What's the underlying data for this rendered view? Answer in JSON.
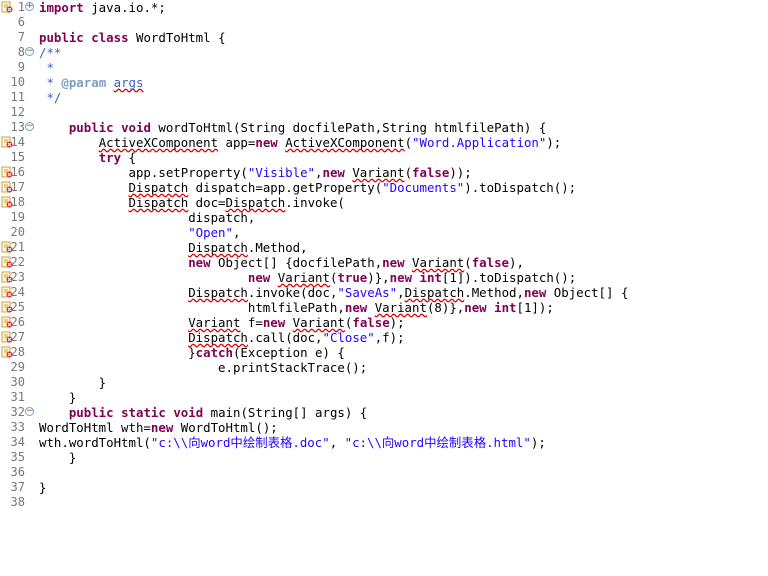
{
  "editor": {
    "lines": [
      {
        "n": "1",
        "fold": "plus",
        "marker": true,
        "tokens": [
          {
            "t": "import",
            "c": "kw"
          },
          {
            "t": " java.io.*;"
          }
        ]
      },
      {
        "n": "6",
        "tokens": []
      },
      {
        "n": "7",
        "tokens": [
          {
            "t": "public",
            "c": "kw"
          },
          {
            "t": " "
          },
          {
            "t": "class",
            "c": "kw"
          },
          {
            "t": " WordToHtml {"
          }
        ]
      },
      {
        "n": "8",
        "fold": "minus",
        "tokens": [
          {
            "t": "/**",
            "c": "cmt"
          }
        ]
      },
      {
        "n": "9",
        "tokens": [
          {
            "t": " *",
            "c": "cmt"
          }
        ]
      },
      {
        "n": "10",
        "tokens": [
          {
            "t": " * ",
            "c": "cmt"
          },
          {
            "t": "@param",
            "c": "tag"
          },
          {
            "t": " ",
            "c": "cmt"
          },
          {
            "t": "args",
            "c": "cmt err"
          }
        ]
      },
      {
        "n": "11",
        "tokens": [
          {
            "t": " */",
            "c": "cmt"
          }
        ]
      },
      {
        "n": "12",
        "tokens": []
      },
      {
        "n": "13",
        "fold": "minus",
        "tokens": [
          {
            "t": "    "
          },
          {
            "t": "public",
            "c": "kw"
          },
          {
            "t": " "
          },
          {
            "t": "void",
            "c": "kw"
          },
          {
            "t": " wordToHtml(String docfilePath,String htmlfilePath) {"
          }
        ]
      },
      {
        "n": "14",
        "marker": true,
        "tokens": [
          {
            "t": "        "
          },
          {
            "t": "ActiveXComponent",
            "c": "err"
          },
          {
            "t": " app="
          },
          {
            "t": "new",
            "c": "kw"
          },
          {
            "t": " "
          },
          {
            "t": "ActiveXComponent",
            "c": "err"
          },
          {
            "t": "("
          },
          {
            "t": "\"Word.Application\"",
            "c": "str"
          },
          {
            "t": ");"
          }
        ]
      },
      {
        "n": "15",
        "tokens": [
          {
            "t": "        "
          },
          {
            "t": "try",
            "c": "kw"
          },
          {
            "t": " {"
          }
        ]
      },
      {
        "n": "16",
        "marker": true,
        "tokens": [
          {
            "t": "            app.setProperty("
          },
          {
            "t": "\"Visible\"",
            "c": "str"
          },
          {
            "t": ","
          },
          {
            "t": "new",
            "c": "kw"
          },
          {
            "t": " "
          },
          {
            "t": "Variant",
            "c": "err"
          },
          {
            "t": "("
          },
          {
            "t": "false",
            "c": "kw"
          },
          {
            "t": "));"
          }
        ]
      },
      {
        "n": "17",
        "marker": true,
        "tokens": [
          {
            "t": "            "
          },
          {
            "t": "Dispatch",
            "c": "err"
          },
          {
            "t": " dispatch=app.getProperty("
          },
          {
            "t": "\"Documents\"",
            "c": "str"
          },
          {
            "t": ").toDispatch();"
          }
        ]
      },
      {
        "n": "18",
        "marker": true,
        "tokens": [
          {
            "t": "            "
          },
          {
            "t": "Dispatch",
            "c": "err"
          },
          {
            "t": " doc="
          },
          {
            "t": "Dispatch",
            "c": "err"
          },
          {
            "t": ".invoke("
          }
        ]
      },
      {
        "n": "19",
        "tokens": [
          {
            "t": "                    dispatch,"
          }
        ]
      },
      {
        "n": "20",
        "tokens": [
          {
            "t": "                    "
          },
          {
            "t": "\"Open\"",
            "c": "str"
          },
          {
            "t": ","
          }
        ]
      },
      {
        "n": "21",
        "marker": true,
        "tokens": [
          {
            "t": "                    "
          },
          {
            "t": "Dispatch",
            "c": "err"
          },
          {
            "t": ".Method,"
          }
        ]
      },
      {
        "n": "22",
        "marker": true,
        "tokens": [
          {
            "t": "                    "
          },
          {
            "t": "new",
            "c": "kw"
          },
          {
            "t": " Object[] {docfilePath,"
          },
          {
            "t": "new",
            "c": "kw"
          },
          {
            "t": " "
          },
          {
            "t": "Variant",
            "c": "err"
          },
          {
            "t": "("
          },
          {
            "t": "false",
            "c": "kw"
          },
          {
            "t": "),"
          }
        ]
      },
      {
        "n": "23",
        "marker": true,
        "tokens": [
          {
            "t": "                            "
          },
          {
            "t": "new",
            "c": "kw"
          },
          {
            "t": " "
          },
          {
            "t": "Variant",
            "c": "err"
          },
          {
            "t": "("
          },
          {
            "t": "true",
            "c": "kw"
          },
          {
            "t": ")},"
          },
          {
            "t": "new",
            "c": "kw"
          },
          {
            "t": " "
          },
          {
            "t": "int",
            "c": "kw"
          },
          {
            "t": "[1]).toDispatch();"
          }
        ]
      },
      {
        "n": "24",
        "marker": true,
        "tokens": [
          {
            "t": "                    "
          },
          {
            "t": "Dispatch",
            "c": "err"
          },
          {
            "t": ".invoke(doc,"
          },
          {
            "t": "\"SaveAs\"",
            "c": "str"
          },
          {
            "t": ","
          },
          {
            "t": "Dispatch",
            "c": "err"
          },
          {
            "t": ".Method,"
          },
          {
            "t": "new",
            "c": "kw"
          },
          {
            "t": " Object[] {"
          }
        ]
      },
      {
        "n": "25",
        "marker": true,
        "tokens": [
          {
            "t": "                            htmlfilePath,"
          },
          {
            "t": "new",
            "c": "kw"
          },
          {
            "t": " "
          },
          {
            "t": "Variant",
            "c": "err"
          },
          {
            "t": "(8)},"
          },
          {
            "t": "new",
            "c": "kw"
          },
          {
            "t": " "
          },
          {
            "t": "int",
            "c": "kw"
          },
          {
            "t": "[1]);"
          }
        ]
      },
      {
        "n": "26",
        "marker": true,
        "tokens": [
          {
            "t": "                    "
          },
          {
            "t": "Variant",
            "c": "err"
          },
          {
            "t": " f="
          },
          {
            "t": "new",
            "c": "kw"
          },
          {
            "t": " "
          },
          {
            "t": "Variant",
            "c": "err"
          },
          {
            "t": "("
          },
          {
            "t": "false",
            "c": "kw"
          },
          {
            "t": ");"
          }
        ]
      },
      {
        "n": "27",
        "marker": true,
        "tokens": [
          {
            "t": "                    "
          },
          {
            "t": "Dispatch",
            "c": "err"
          },
          {
            "t": ".call(doc,"
          },
          {
            "t": "\"Close\"",
            "c": "str"
          },
          {
            "t": ",f);"
          }
        ]
      },
      {
        "n": "28",
        "marker": true,
        "tokens": [
          {
            "t": "                    }"
          },
          {
            "t": "catch",
            "c": "kw"
          },
          {
            "t": "(Exception e) {"
          }
        ]
      },
      {
        "n": "29",
        "tokens": [
          {
            "t": "                        e.printStackTrace();"
          }
        ]
      },
      {
        "n": "30",
        "tokens": [
          {
            "t": "        }"
          }
        ]
      },
      {
        "n": "31",
        "tokens": [
          {
            "t": "    }"
          }
        ]
      },
      {
        "n": "32",
        "fold": "minus",
        "tokens": [
          {
            "t": "    "
          },
          {
            "t": "public",
            "c": "kw"
          },
          {
            "t": " "
          },
          {
            "t": "static",
            "c": "kw"
          },
          {
            "t": " "
          },
          {
            "t": "void",
            "c": "kw"
          },
          {
            "t": " main(String[] args) {"
          }
        ]
      },
      {
        "n": "33",
        "tokens": [
          {
            "t": "WordToHtml wth="
          },
          {
            "t": "new",
            "c": "kw"
          },
          {
            "t": " WordToHtml();"
          }
        ]
      },
      {
        "n": "34",
        "tokens": [
          {
            "t": "wth.wordToHtml("
          },
          {
            "t": "\"c:\\\\向word中绘制表格.doc\"",
            "c": "str"
          },
          {
            "t": ", "
          },
          {
            "t": "\"c:\\\\向word中绘制表格.html\"",
            "c": "str"
          },
          {
            "t": ");"
          }
        ]
      },
      {
        "n": "35",
        "tokens": [
          {
            "t": "    }"
          }
        ]
      },
      {
        "n": "36",
        "tokens": []
      },
      {
        "n": "37",
        "tokens": [
          {
            "t": "}"
          }
        ]
      },
      {
        "n": "38",
        "tokens": []
      }
    ]
  },
  "colors": {
    "keyword": "#7f0055",
    "string": "#2a00ff",
    "comment": "#3f5fbf",
    "javadoc_tag": "#7f9fbf",
    "error_underline": "#e00000",
    "line_number": "#787878",
    "marker_icon": "error-marker-icon"
  }
}
